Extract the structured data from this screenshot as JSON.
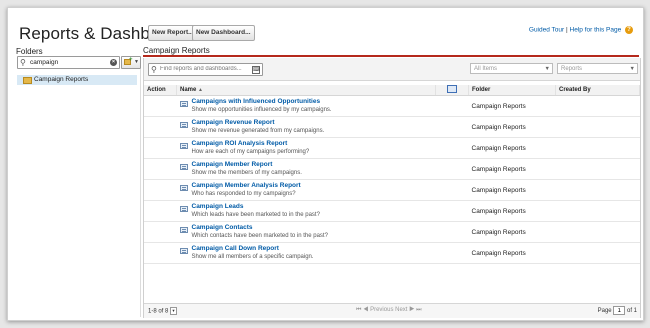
{
  "header": {
    "title": "Reports & Dashboards",
    "new_report": "New Report...",
    "new_dashboard": "New Dashboard...",
    "guided_tour": "Guided Tour",
    "separator": "|",
    "help_page": "Help for this Page",
    "help_icon": "?"
  },
  "folders": {
    "title": "Folders",
    "search_value": "campaign",
    "items": [
      {
        "label": "Campaign Reports"
      }
    ]
  },
  "main": {
    "title": "Campaign Reports",
    "find_placeholder": "Find reports and dashboards...",
    "filter_items": "All Items",
    "filter_type": "Reports",
    "columns": {
      "action": "Action",
      "name": "Name",
      "name_sort": "▲",
      "folder": "Folder",
      "created_by": "Created By"
    },
    "rows": [
      {
        "name": "Campaigns with Influenced Opportunities",
        "desc": "Show me opportunities influenced by my campaigns.",
        "folder": "Campaign Reports",
        "created_by": ""
      },
      {
        "name": "Campaign Revenue Report",
        "desc": "Show me revenue generated from my campaigns.",
        "folder": "Campaign Reports",
        "created_by": ""
      },
      {
        "name": "Campaign ROI Analysis Report",
        "desc": "How are each of my campaigns performing?",
        "folder": "Campaign Reports",
        "created_by": ""
      },
      {
        "name": "Campaign Member Report",
        "desc": "Show me the members of my campaigns.",
        "folder": "Campaign Reports",
        "created_by": ""
      },
      {
        "name": "Campaign Member Analysis Report",
        "desc": "Who has responded to my campaigns?",
        "folder": "Campaign Reports",
        "created_by": ""
      },
      {
        "name": "Campaign Leads",
        "desc": "Which leads have been marketed to in the past?",
        "folder": "Campaign Reports",
        "created_by": ""
      },
      {
        "name": "Campaign Contacts",
        "desc": "Which contacts have been marketed to in the past?",
        "folder": "Campaign Reports",
        "created_by": ""
      },
      {
        "name": "Campaign Call Down Report",
        "desc": "Show me all members of a specific campaign.",
        "folder": "Campaign Reports",
        "created_by": ""
      }
    ],
    "footer": {
      "count": "1-8 of 8",
      "first": "⏮",
      "prev": "◀ Previous",
      "next": "Next ▶",
      "last": "⏭",
      "page_label": "Page",
      "page_value": "1",
      "of_total": "of 1"
    }
  },
  "colors": {
    "link": "#015ba7",
    "accent_line": "#b5291c",
    "selected_folder": "#d8e9f5"
  },
  "icons": [
    "search-icon",
    "clear-icon",
    "folder-icon",
    "report-icon",
    "help-icon",
    "keyboard-icon",
    "chevron-down-icon"
  ]
}
